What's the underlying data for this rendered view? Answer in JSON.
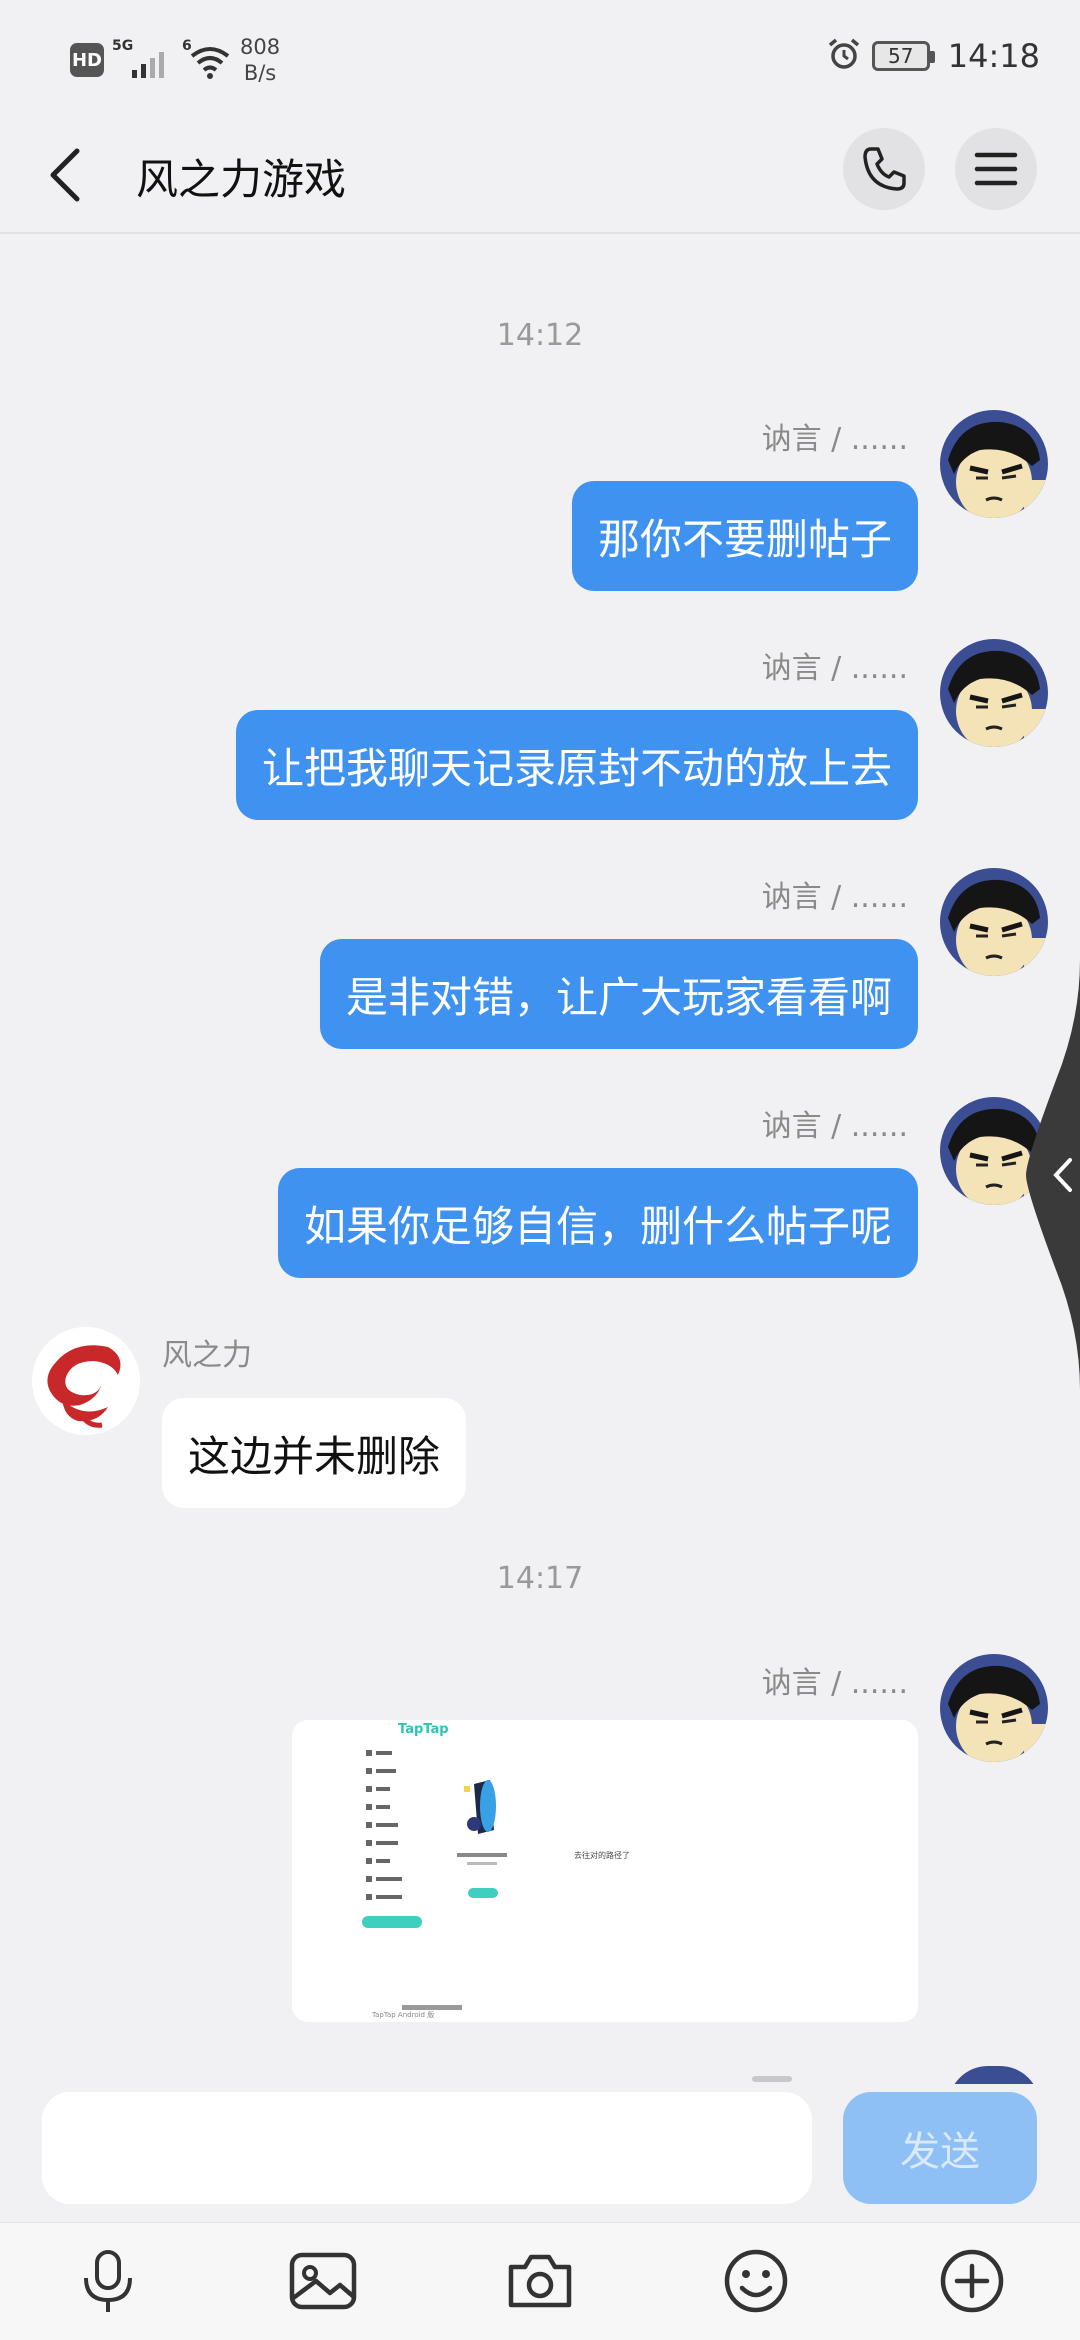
{
  "status_bar": {
    "hd": "HD",
    "signal1": "5G",
    "signal2": "6",
    "speed_value": "808",
    "speed_unit": "B/s",
    "battery": "57",
    "time": "14:18"
  },
  "header": {
    "title": "风之力游戏",
    "back_icon": "chevron-left-icon",
    "call_icon": "phone-icon",
    "menu_icon": "menu-icon"
  },
  "chat": {
    "timestamps": [
      "14:12",
      "14:17"
    ],
    "my_nick": "讷言 / ......",
    "messages_sent": [
      "那你不要删帖子",
      "让把我聊天记录原封不动的放上去",
      "是非对错，让广大玩家看看啊",
      "如果你足够自信，删什么帖子呢"
    ],
    "other_nick": "风之力",
    "message_received": "这边并未删除",
    "image_preview": {
      "brand": "TapTap",
      "caption": "去往对的路径了",
      "footer": "TapTap Android 版"
    }
  },
  "input": {
    "placeholder": "",
    "send_label": "发送"
  },
  "toolbar": {
    "items": [
      "microphone-icon",
      "image-icon",
      "camera-icon",
      "emoji-icon",
      "plus-icon"
    ]
  },
  "colors": {
    "bubble_sent": "#3f92f0",
    "bubble_received": "#ffffff",
    "background": "#f1f1f3",
    "send_disabled": "#8ec0f5"
  }
}
